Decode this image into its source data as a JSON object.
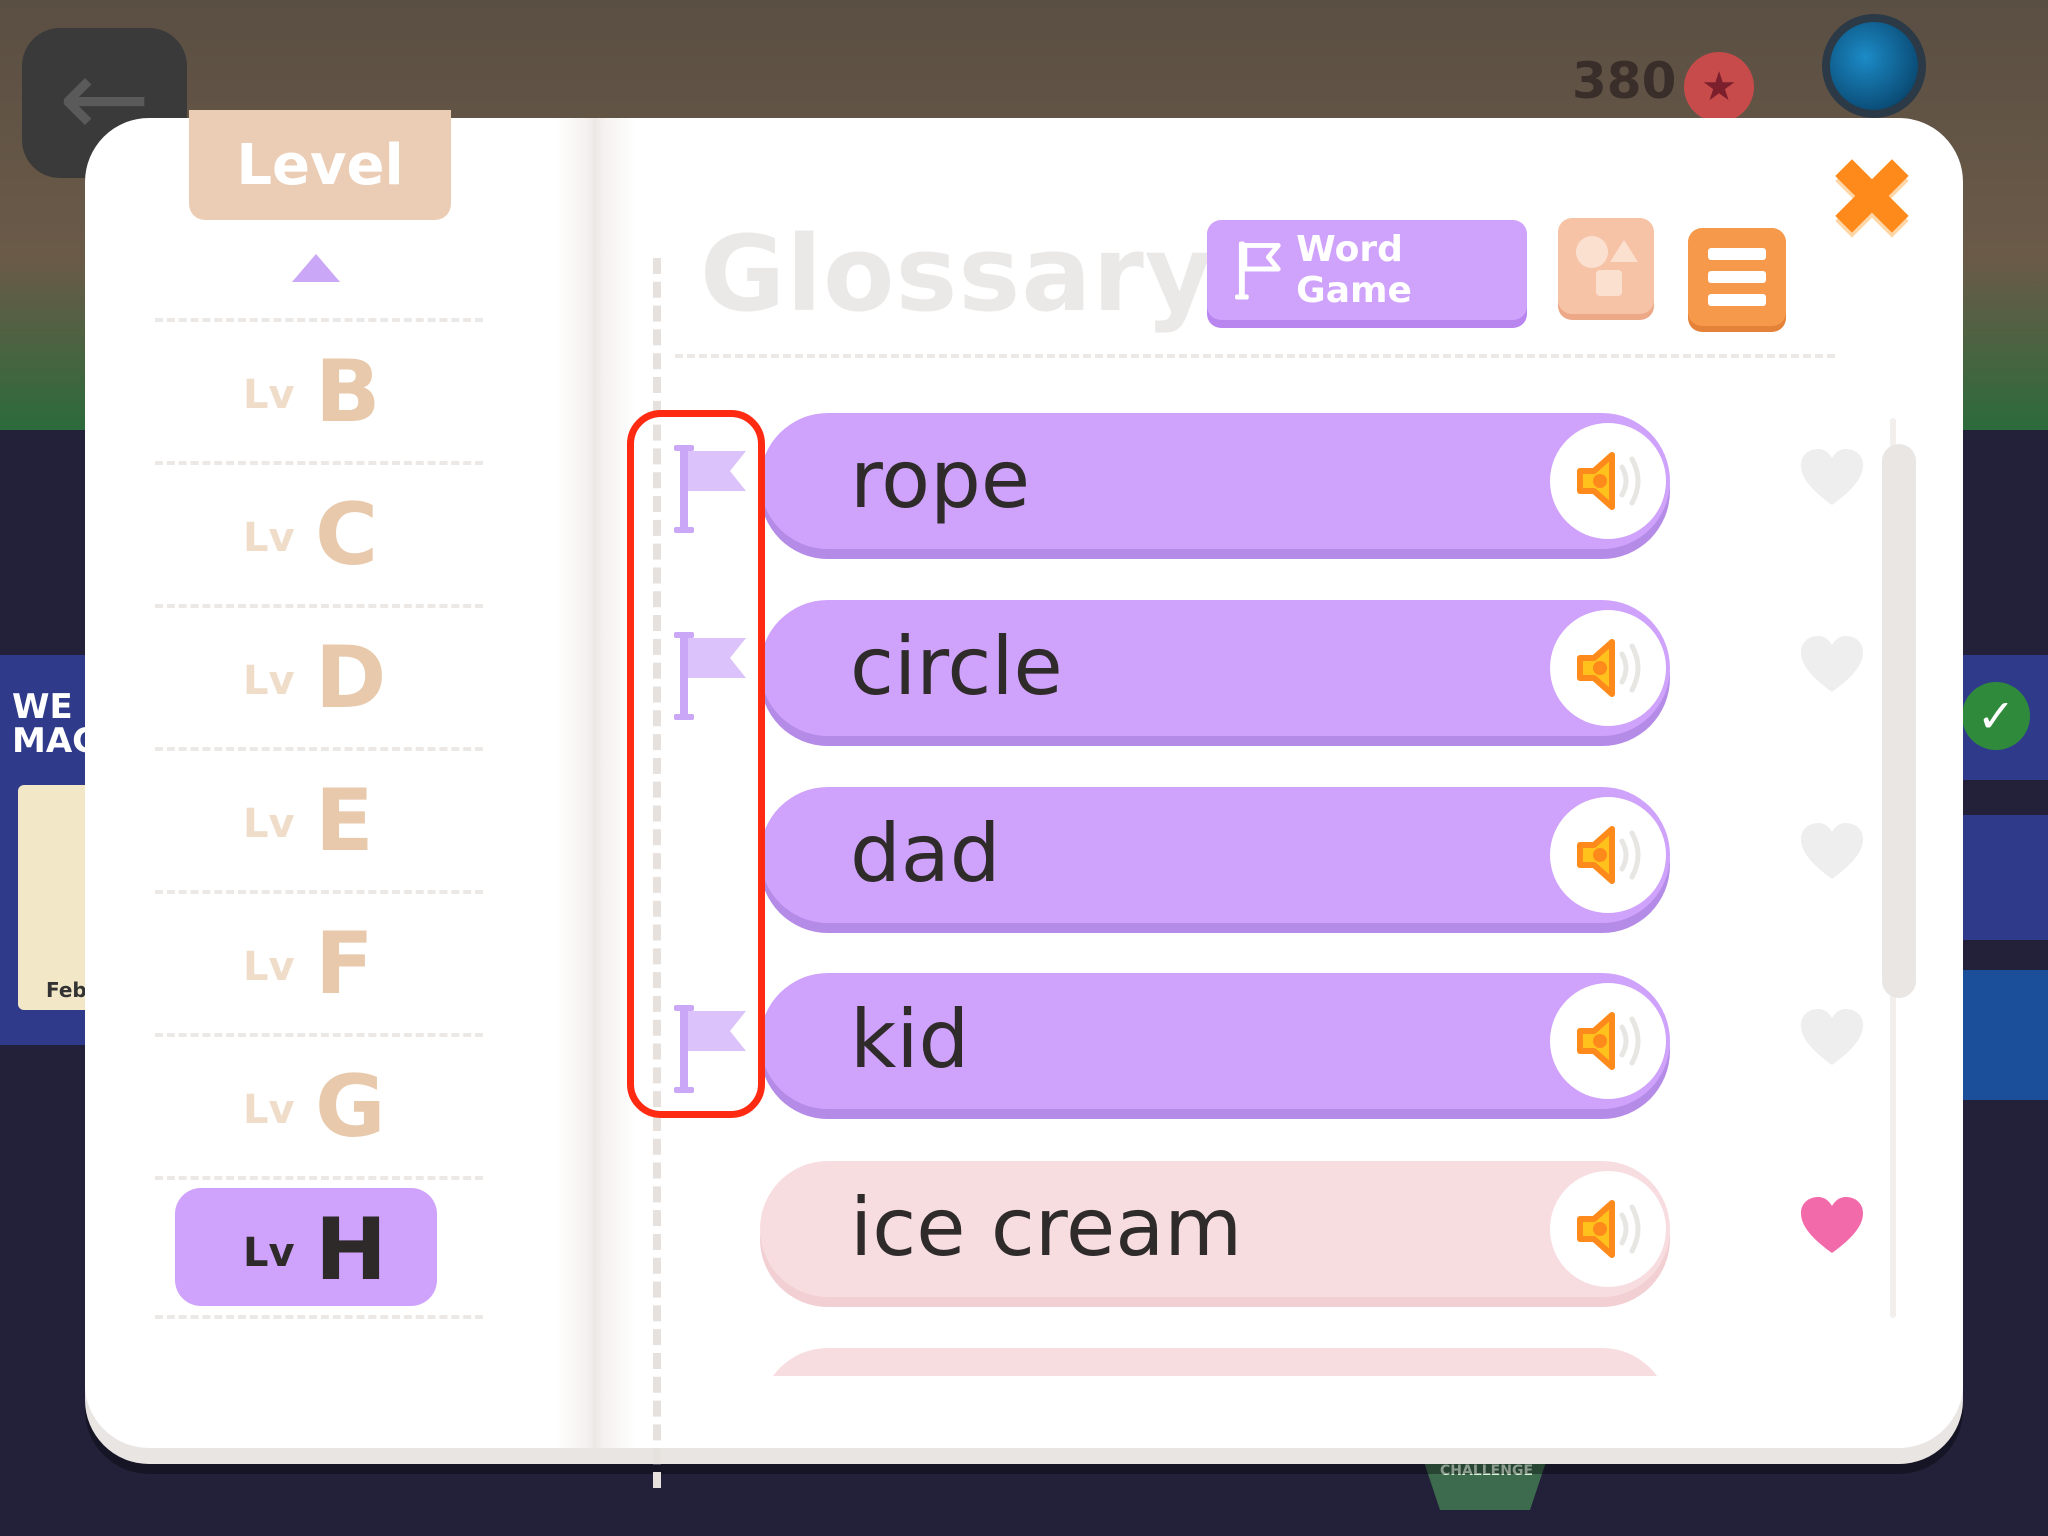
{
  "background": {
    "coins": "380",
    "left_card_text": "WE MAG",
    "left_card_sub": "Feb",
    "bottom_badge": "CHALLENGE"
  },
  "dialog": {
    "level_tab": "Level",
    "levels": [
      {
        "prefix": "Lv",
        "letter": "B",
        "active": false
      },
      {
        "prefix": "Lv",
        "letter": "C",
        "active": false
      },
      {
        "prefix": "Lv",
        "letter": "D",
        "active": false
      },
      {
        "prefix": "Lv",
        "letter": "E",
        "active": false
      },
      {
        "prefix": "Lv",
        "letter": "F",
        "active": false
      },
      {
        "prefix": "Lv",
        "letter": "G",
        "active": false
      },
      {
        "prefix": "Lv",
        "letter": "H",
        "active": true
      }
    ],
    "title": "Glossary",
    "word_game_label": "Word Game",
    "close_icon": "close-icon",
    "words": [
      {
        "word": "rope",
        "flagged": true,
        "favorite": false,
        "style": "purple"
      },
      {
        "word": "circle",
        "flagged": true,
        "favorite": false,
        "style": "purple"
      },
      {
        "word": "dad",
        "flagged": false,
        "favorite": false,
        "style": "purple"
      },
      {
        "word": "kid",
        "flagged": true,
        "favorite": false,
        "style": "purple"
      },
      {
        "word": "ice cream",
        "flagged": false,
        "favorite": true,
        "style": "pink"
      }
    ]
  },
  "colors": {
    "accent_purple": "#cfa2fb",
    "accent_orange": "#ff8a1c",
    "heart_favorite": "#f26aa9",
    "heart_default": "#eeeeee",
    "highlight": "#ff2a12"
  }
}
